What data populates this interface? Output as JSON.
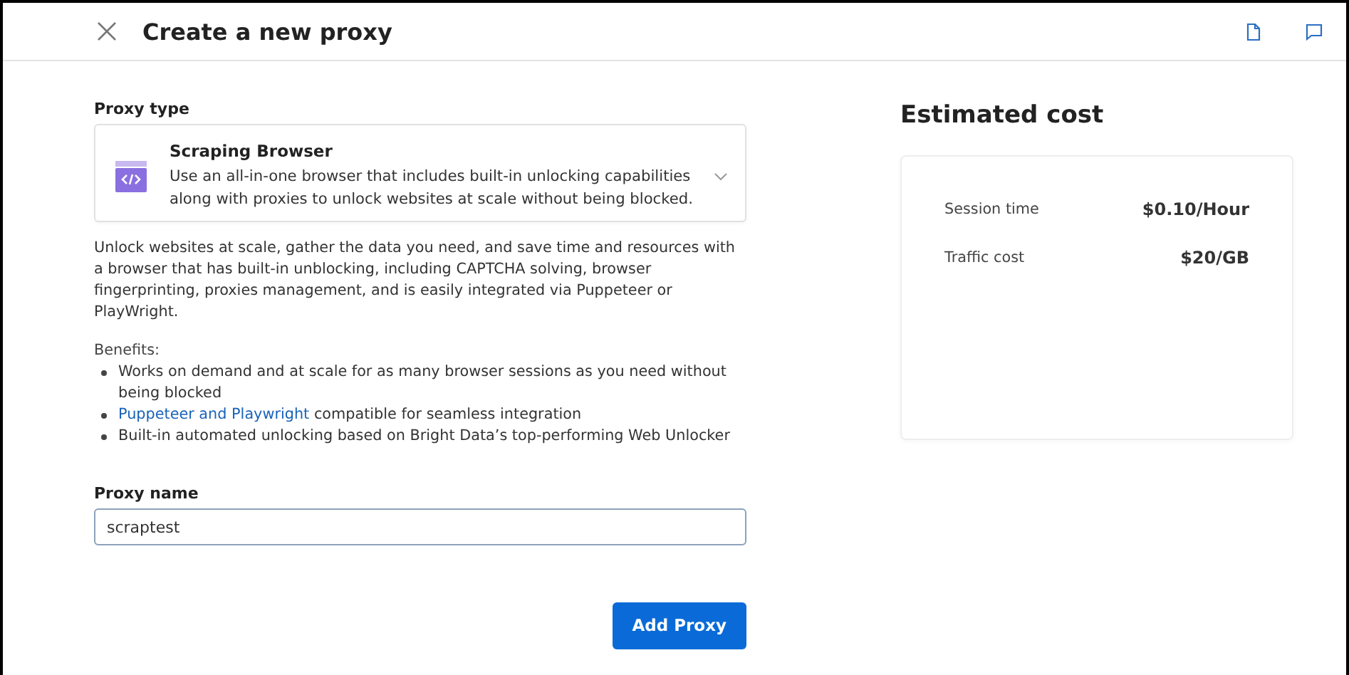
{
  "header": {
    "title": "Create a new proxy"
  },
  "proxy_type": {
    "label": "Proxy type",
    "option": {
      "name": "Scraping Browser",
      "description": "Use an all-in-one browser that includes built-in unlocking capabilities along with proxies to unlock websites at scale without being blocked."
    }
  },
  "description": "Unlock websites at scale, gather the data you need, and save time and resources with a browser that has built-in unblocking, including CAPTCHA solving, browser fingerprinting, proxies management, and is easily integrated via Puppeteer or PlayWright.",
  "benefits": {
    "title": "Benefits:",
    "items": [
      [
        {
          "kind": "text",
          "text": "Works on demand and at scale for as many browser sessions as you need without being blocked"
        }
      ],
      [
        {
          "kind": "link",
          "text": "Puppeteer and Playwright"
        },
        {
          "kind": "text",
          "text": "compatible for seamless integration"
        }
      ],
      [
        {
          "kind": "text",
          "text": "Built-in automated unlocking based on Bright Data’s top-performing Web Unlocker"
        }
      ]
    ]
  },
  "proxy_name": {
    "label": "Proxy name",
    "value": "scraptest"
  },
  "submit": "Add Proxy",
  "estimated_cost": {
    "title": "Estimated cost",
    "rows": [
      {
        "label": "Session time",
        "value": "$0.10/Hour"
      },
      {
        "label": "Traffic cost",
        "value": "$20/GB"
      }
    ]
  }
}
